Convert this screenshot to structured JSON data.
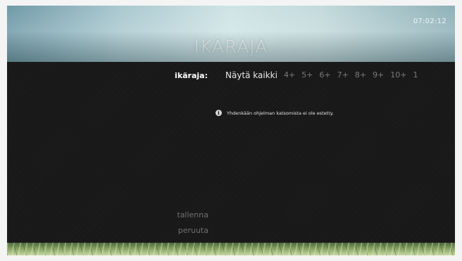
{
  "header": {
    "title": "IKÄRAJA",
    "clock": "07:02:12"
  },
  "filter": {
    "label": "ikäraja:",
    "options": [
      "Näytä kaikki",
      "4+",
      "5+",
      "6+",
      "7+",
      "8+",
      "9+",
      "10+",
      "1"
    ],
    "selected": "Näytä kaikki"
  },
  "info": {
    "icon": "info-icon",
    "text": "Yhdenkään ohjelman katsomista ei ole estetty."
  },
  "actions": {
    "save_label": "tallenna",
    "cancel_label": "peruuta"
  },
  "colors": {
    "panel_background": "#1a1a1a",
    "selected_text": "#e9e9e9",
    "dim_text": "#7a7a7a"
  }
}
